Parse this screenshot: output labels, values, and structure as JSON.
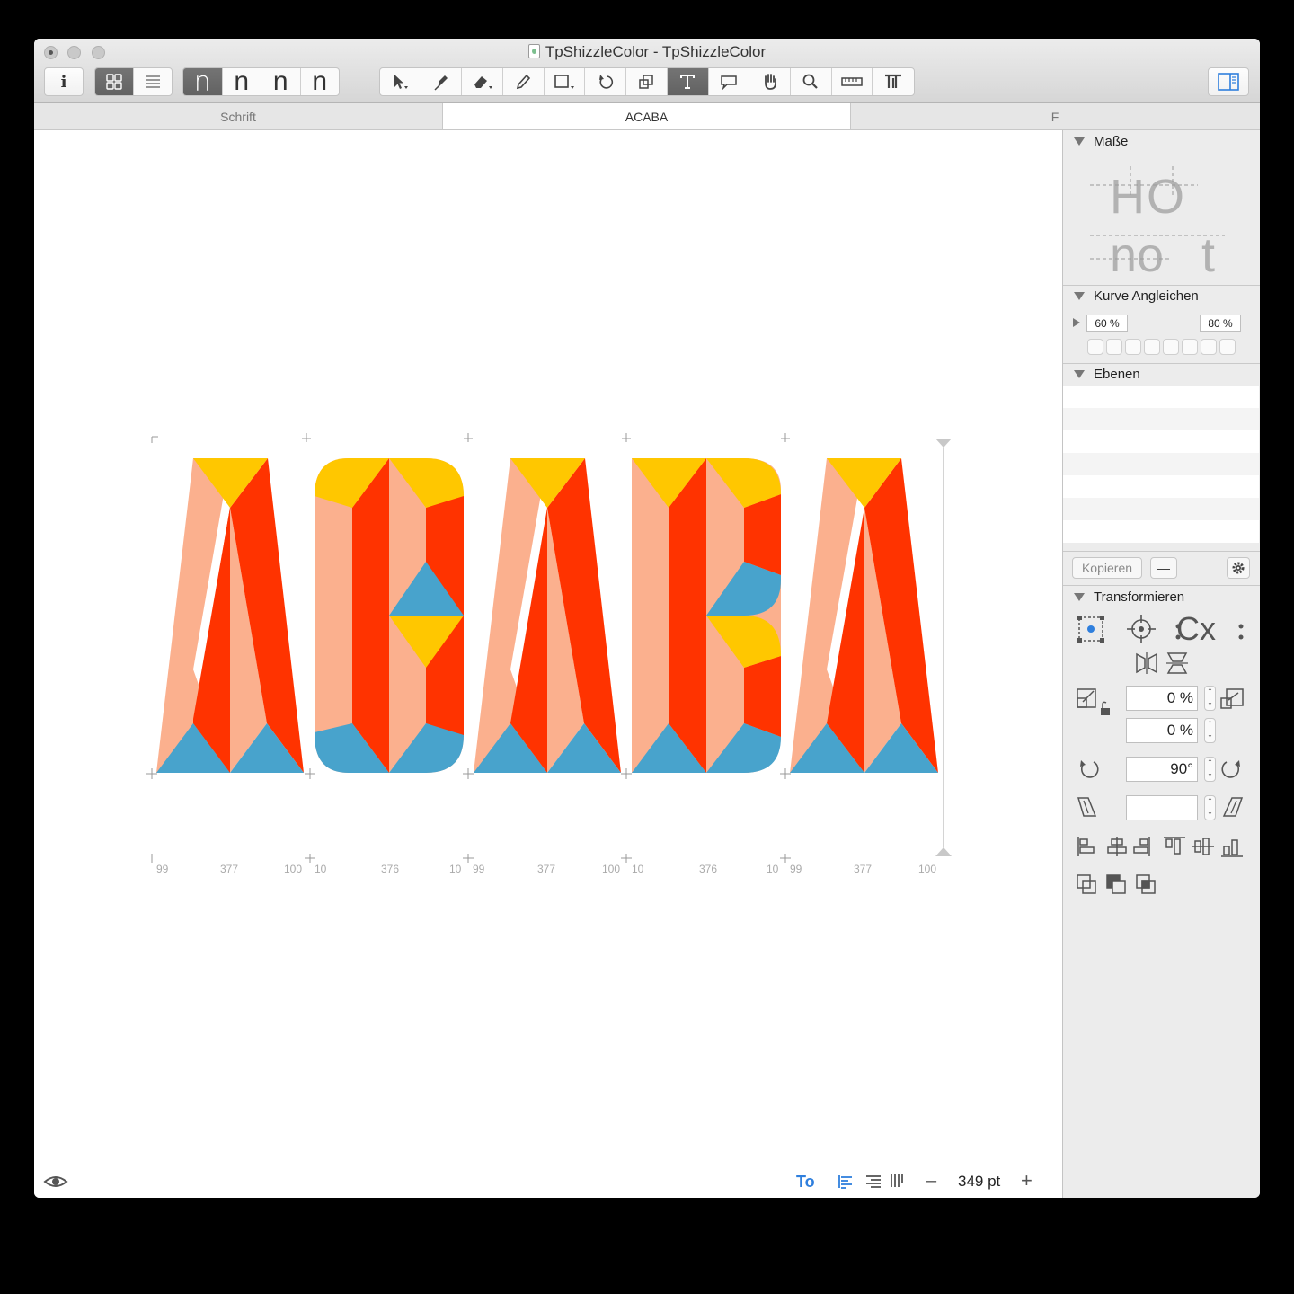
{
  "window": {
    "title": "TpShizzleColor - TpShizzleColor"
  },
  "toolbar": {
    "info_label": "i",
    "glyph_styles": [
      "n",
      "n",
      "n",
      "n"
    ]
  },
  "tabs": [
    {
      "label": "Schrift"
    },
    {
      "label": "ACABA"
    },
    {
      "label": "F"
    }
  ],
  "glyph_metrics": [
    "99",
    "377",
    "100",
    "10",
    "376",
    "10",
    "99",
    "377",
    "100",
    "10",
    "376",
    "10",
    "99",
    "377",
    "100"
  ],
  "colors": {
    "peach": "#fbb08e",
    "red": "#ff3300",
    "yellow": "#ffc700",
    "blue": "#48a3cc"
  },
  "bottom": {
    "zoom_value": "349 pt",
    "minus": "–",
    "plus": "+",
    "text_tool": "To"
  },
  "panel": {
    "masse_title": "Maße",
    "masse_preview_line1": "HO",
    "masse_preview_line2a": "no",
    "masse_preview_line2b": "t",
    "kurve_title": "Kurve Angleichen",
    "kurve_left": "60 %",
    "kurve_right": "80 %",
    "ebenen_title": "Ebenen",
    "kopieren_label": "Kopieren",
    "minus_label": "—",
    "transform_title": "Transformieren",
    "transform_cx": "Cx",
    "scale_x": "0 %",
    "scale_y": "0 %",
    "rotate": "90°",
    "slant": ""
  }
}
